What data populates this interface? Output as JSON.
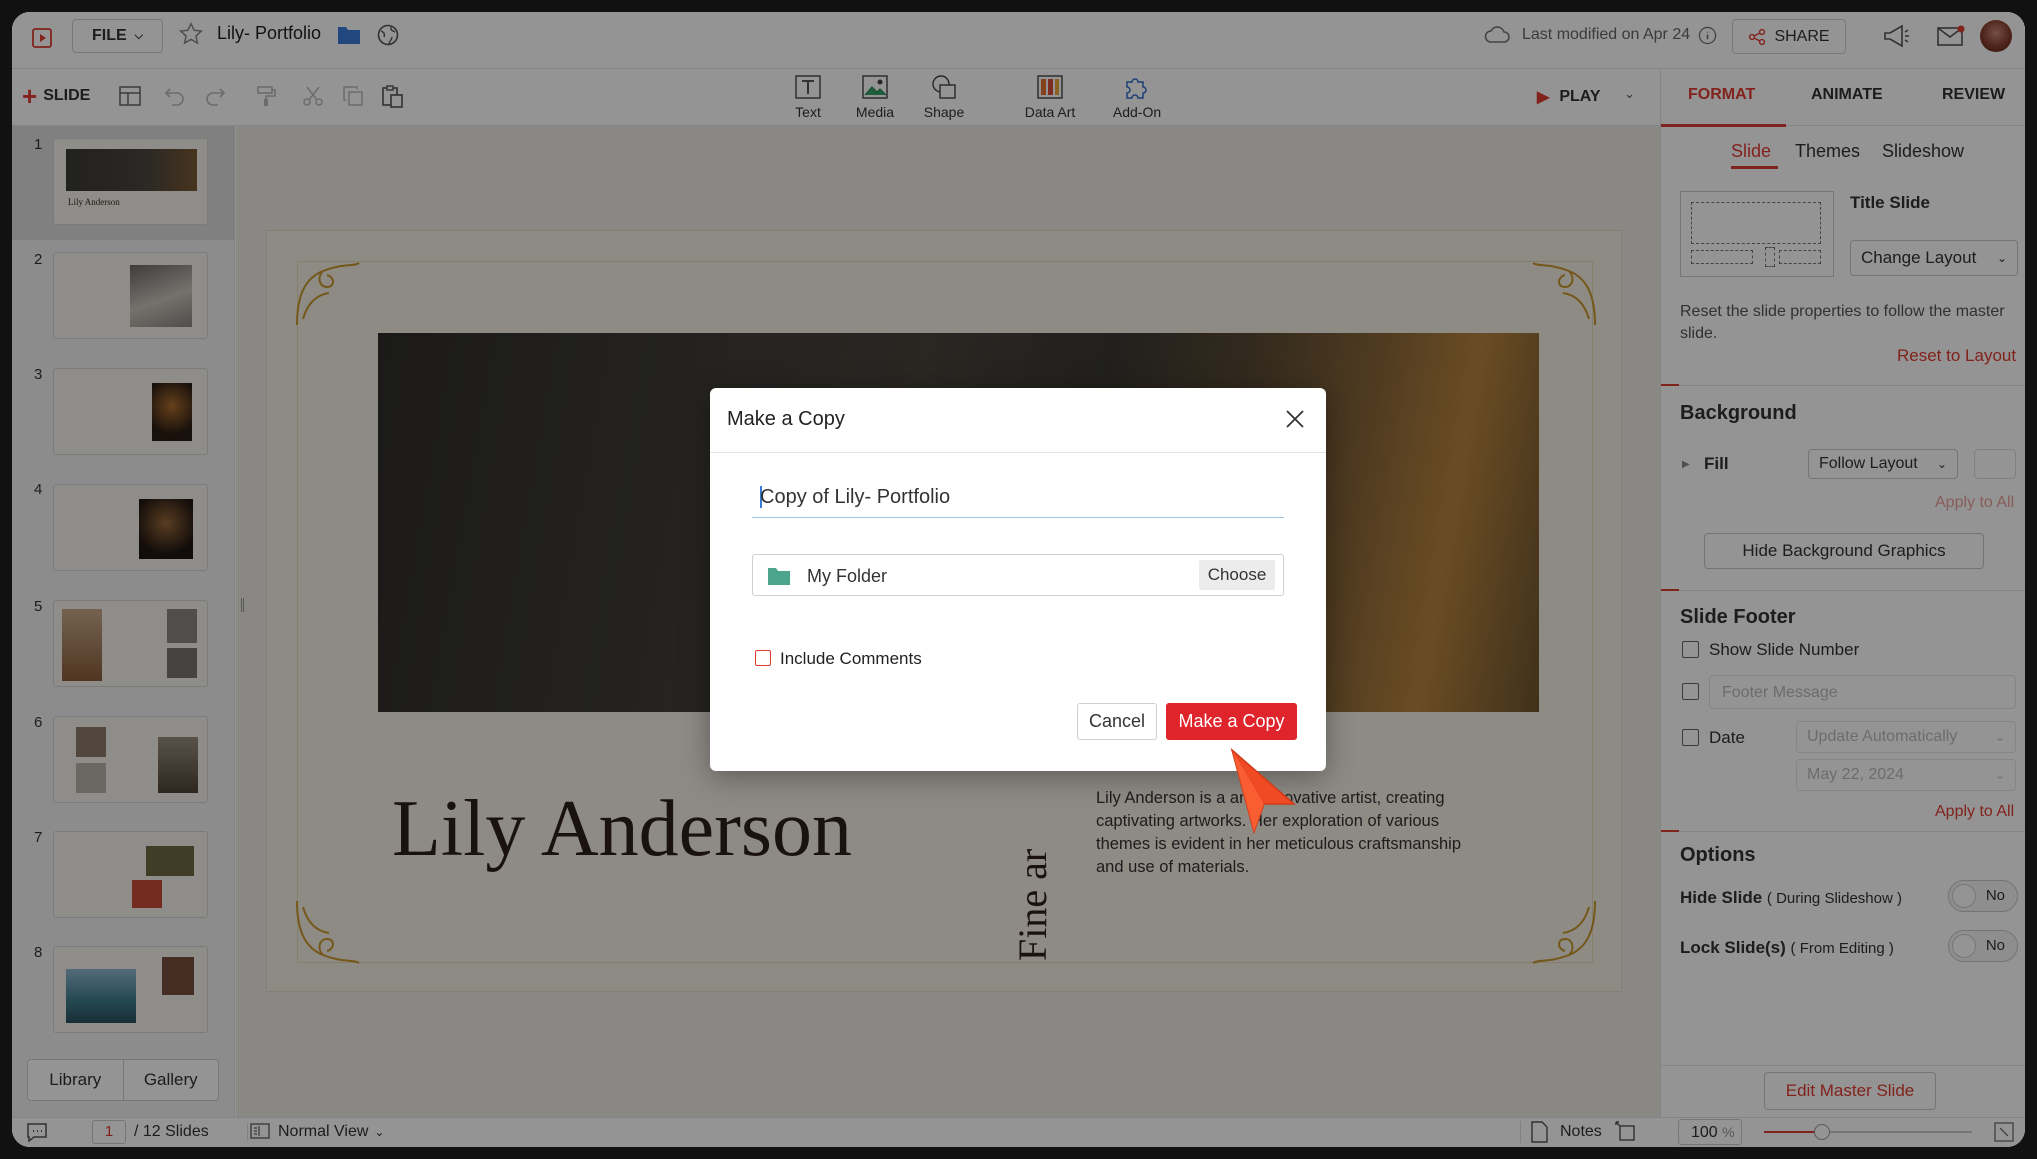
{
  "app": {
    "file_menu": "FILE",
    "doc_title": "Lily- Portfolio",
    "last_modified": "Last modified on Apr 24",
    "share_label": "SHARE"
  },
  "toolbar": {
    "add_slide": "SLIDE",
    "insert": [
      {
        "label": "Text",
        "icon": "text-box-icon"
      },
      {
        "label": "Media",
        "icon": "image-icon"
      },
      {
        "label": "Shape",
        "icon": "shape-icon"
      },
      {
        "label": "Data Art",
        "icon": "data-art-icon"
      },
      {
        "label": "Add-On",
        "icon": "puzzle-icon"
      }
    ],
    "play_label": "PLAY"
  },
  "right_tabs": [
    "FORMAT",
    "ANIMATE",
    "REVIEW"
  ],
  "sub_tabs": [
    "Slide",
    "Themes",
    "Slideshow"
  ],
  "format_panel": {
    "layout_name": "Title Slide",
    "change_layout": "Change Layout",
    "reset_desc": "Reset the slide properties to follow the master slide.",
    "reset_link": "Reset to Layout",
    "background_heading": "Background",
    "fill_label": "Fill",
    "fill_value": "Follow Layout",
    "apply_all_1": "Apply to All",
    "hide_bg_graphics": "Hide Background Graphics",
    "footer_heading": "Slide Footer",
    "show_slide_number": "Show Slide Number",
    "footer_message_placeholder": "Footer Message",
    "date_label": "Date",
    "date_mode": "Update Automatically",
    "date_value": "May 22, 2024",
    "apply_all_2": "Apply to All",
    "options_heading": "Options",
    "hide_slide": "Hide Slide",
    "hide_slide_note": "( During Slideshow )",
    "hide_slide_value": "No",
    "lock_slide": "Lock Slide(s)",
    "lock_slide_note": "( From Editing )",
    "lock_slide_value": "No",
    "edit_master": "Edit Master Slide"
  },
  "slides_panel": {
    "numbers": [
      "1",
      "2",
      "3",
      "4",
      "5",
      "6",
      "7",
      "8"
    ],
    "library": "Library",
    "gallery": "Gallery"
  },
  "slide": {
    "name": "Lily Anderson",
    "vertical_text": "Fine ar",
    "bio": "Lily Anderson is a      and innovative artist, creating captivating artworks. Her exploration of various themes is evident in her meticulous craftsmanship and use of materials."
  },
  "statusbar": {
    "current_slide": "1",
    "total_slides": "/ 12 Slides",
    "view": "Normal View",
    "notes": "Notes",
    "zoom": "100",
    "zoom_unit": "%"
  },
  "dialog": {
    "title": "Make a Copy",
    "name_value": "Copy of Lily- Portfolio",
    "folder": "My Folder",
    "choose": "Choose",
    "include_comments": "Include Comments",
    "cancel": "Cancel",
    "confirm": "Make a Copy"
  },
  "colors": {
    "accent": "#e03c31",
    "folder": "#4aa58c",
    "gold": "#c9972b"
  }
}
